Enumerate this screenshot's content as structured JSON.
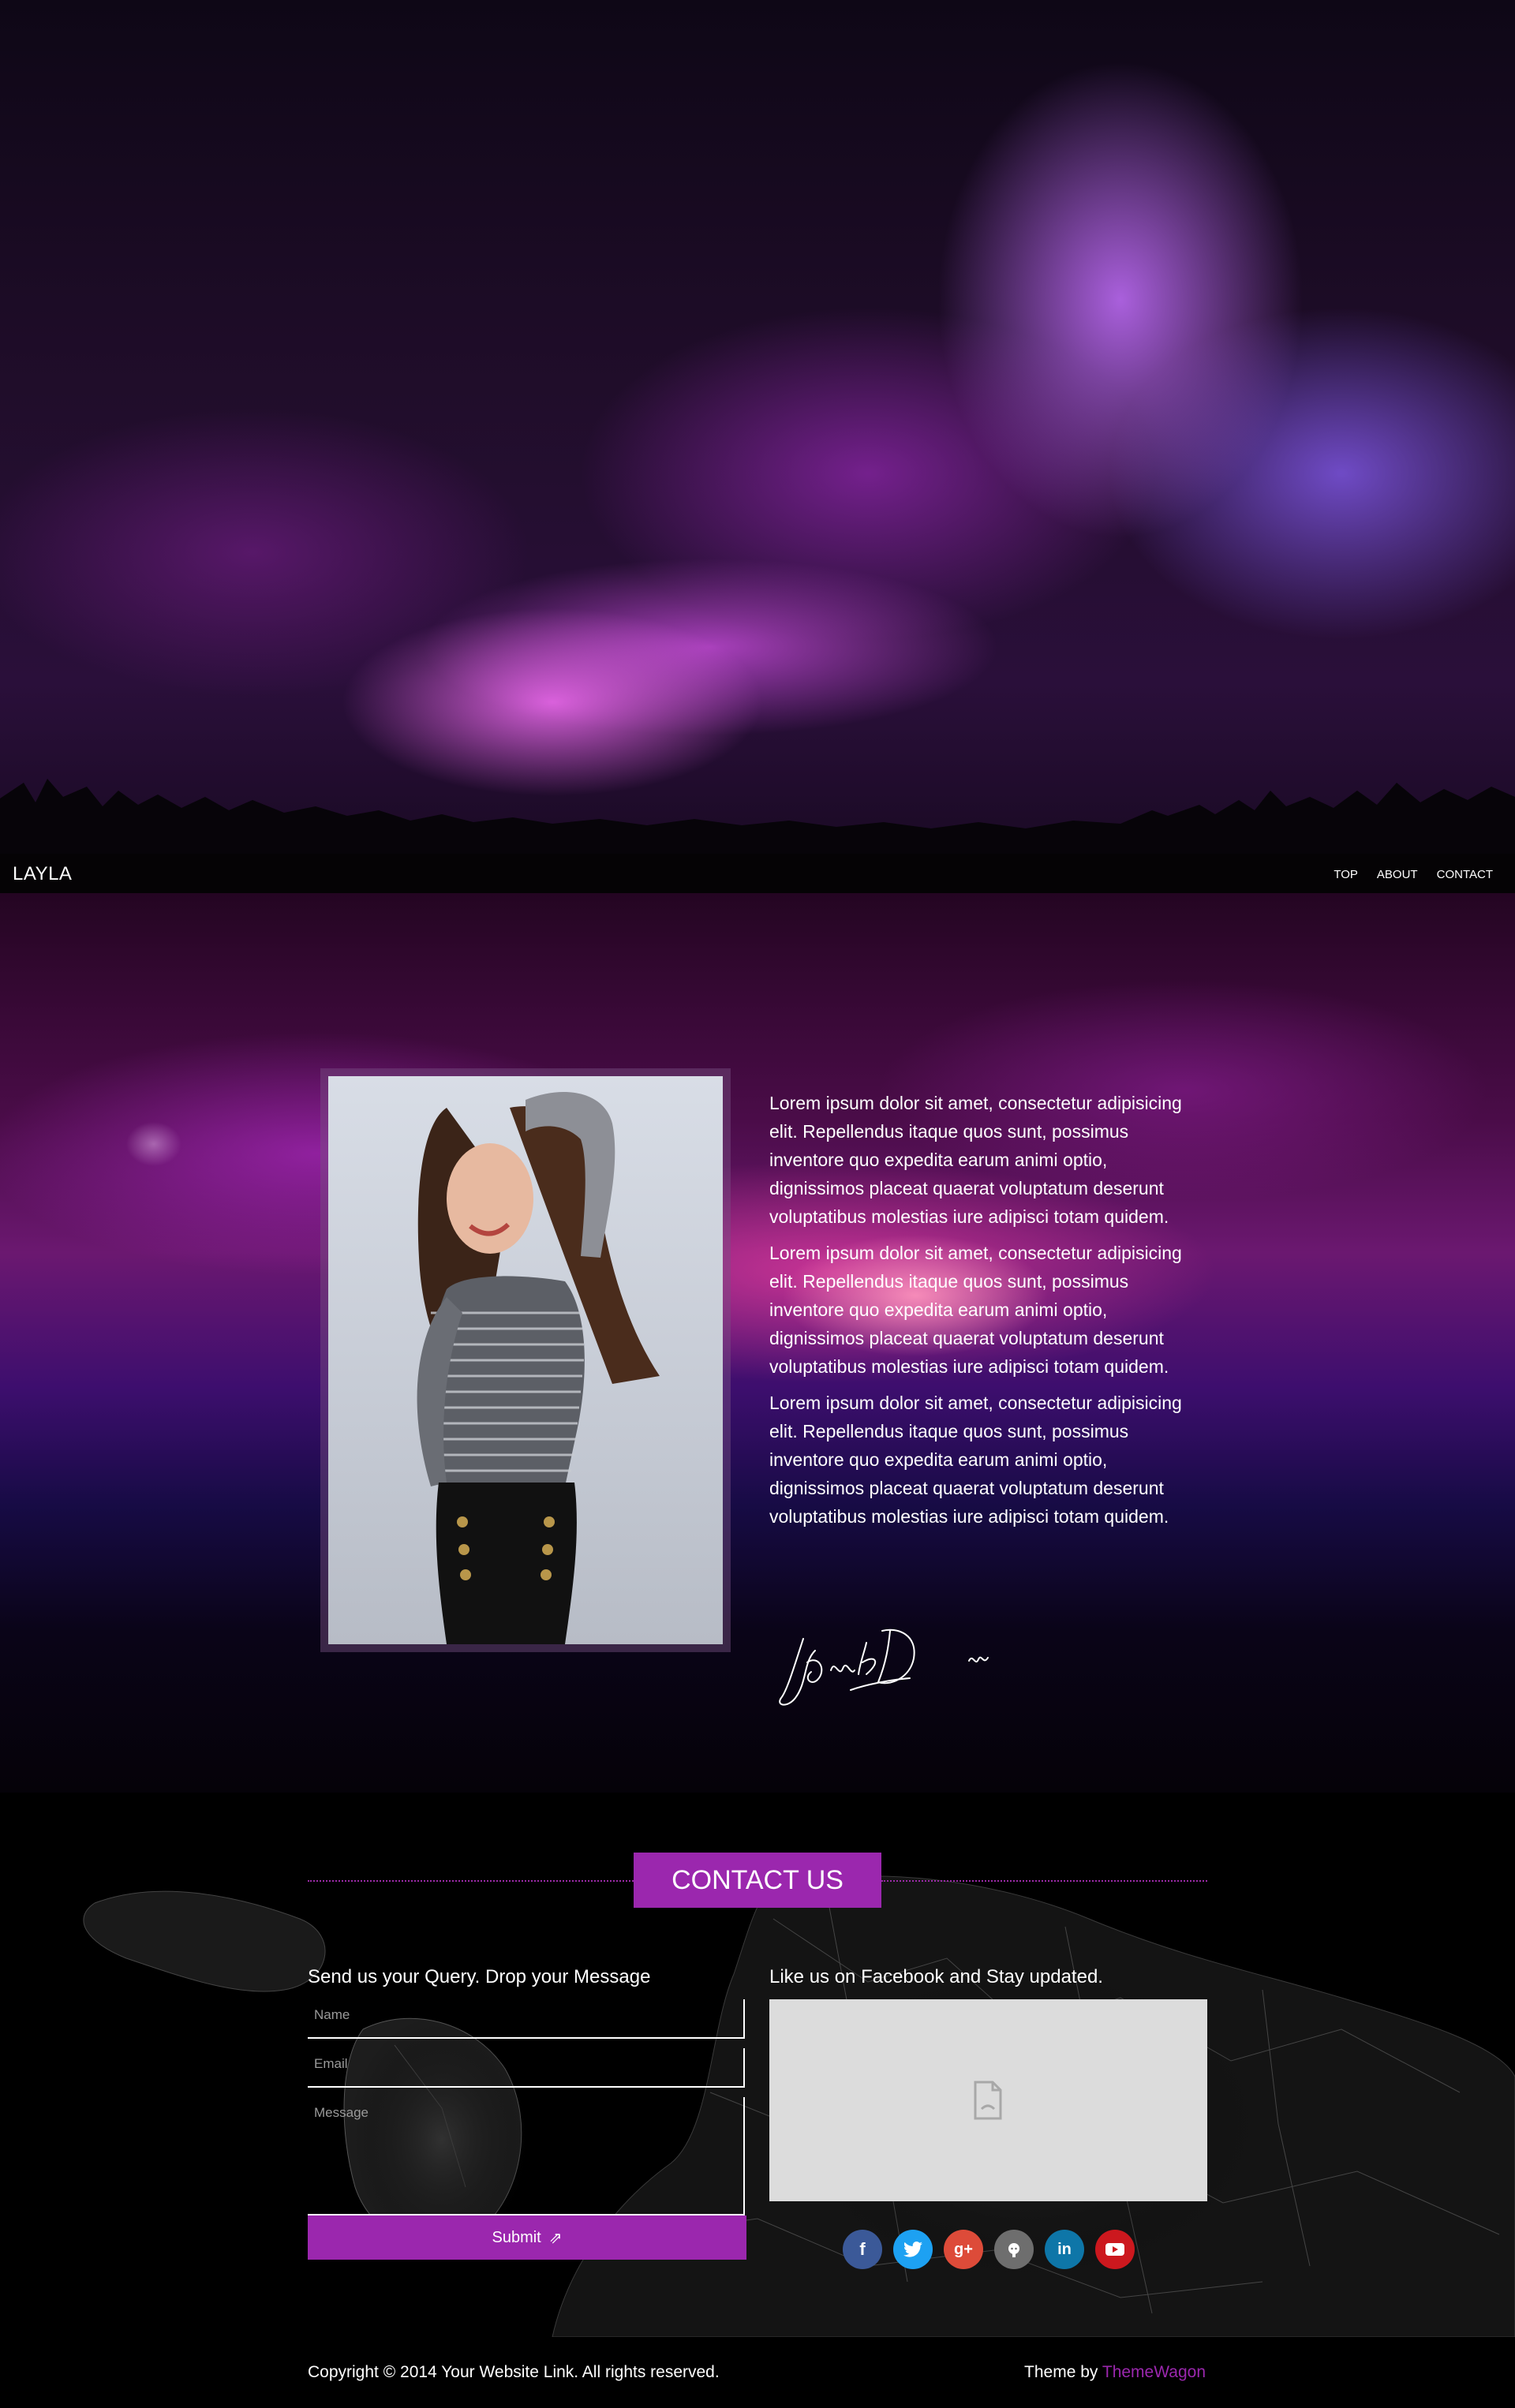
{
  "navbar": {
    "brand": "LAYLA",
    "links": [
      "TOP",
      "ABOUT",
      "CONTACT"
    ]
  },
  "about": {
    "paragraphs": [
      "Lorem ipsum dolor sit amet, consectetur adipisicing elit. Repellendus itaque quos sunt, possimus inventore quo expedita earum animi optio, dignissimos placeat quaerat voluptatum deserunt voluptatibus molestias iure adipisci totam quidem.",
      "Lorem ipsum dolor sit amet, consectetur adipisicing elit. Repellendus itaque quos sunt, possimus inventore quo expedita earum animi optio, dignissimos placeat quaerat voluptatum deserunt voluptatibus molestias iure adipisci totam quidem.",
      "Lorem ipsum dolor sit amet, consectetur adipisicing elit. Repellendus itaque quos sunt, possimus inventore quo expedita earum animi optio, dignissimos placeat quaerat voluptatum deserunt voluptatibus molestias iure adipisci totam quidem."
    ]
  },
  "contact": {
    "title": "CONTACT US",
    "form_heading": "Send us your Query. Drop your Message",
    "social_heading": "Like us on Facebook and Stay updated.",
    "name_placeholder": "Name",
    "email_placeholder": "Email",
    "message_placeholder": "Message",
    "submit_label": "Submit",
    "socials": [
      {
        "name": "facebook-icon",
        "glyph": "f",
        "color": "#3b5998"
      },
      {
        "name": "twitter-icon",
        "glyph": "t",
        "color": "#1da1f2"
      },
      {
        "name": "google-plus-icon",
        "glyph": "g+",
        "color": "#dd4b39"
      },
      {
        "name": "github-icon",
        "glyph": "gh",
        "color": "#6e6e6e"
      },
      {
        "name": "linkedin-icon",
        "glyph": "in",
        "color": "#0e76a8"
      },
      {
        "name": "youtube-icon",
        "glyph": "▶",
        "color": "#cc181e"
      }
    ]
  },
  "footer": {
    "copyright": "Copyright © 2014 Your Website Link. All rights reserved.",
    "theme_prefix": "Theme by ",
    "theme_link": "ThemeWagon"
  },
  "colors": {
    "accent": "#9b27ae",
    "navbar": "#050305",
    "fb_placeholder": "#dcdcdc"
  }
}
